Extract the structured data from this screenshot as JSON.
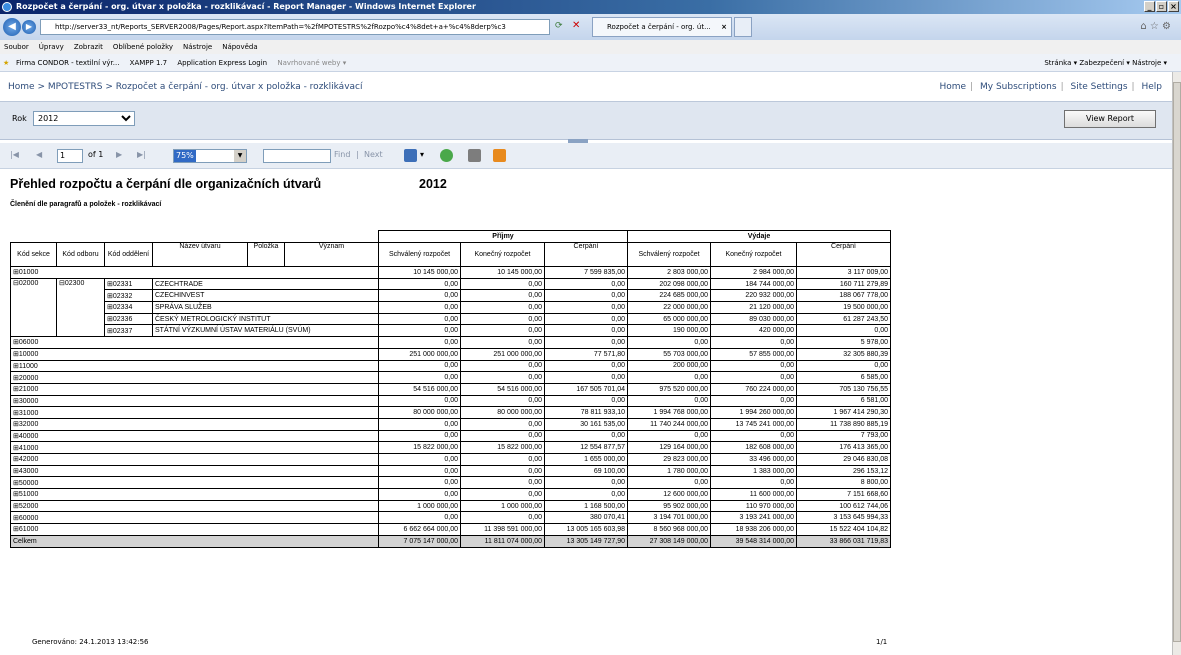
{
  "window": {
    "title": "Rozpočet a čerpání - org. útvar x položka - rozklikávací - Report Manager - Windows Internet Explorer"
  },
  "browser": {
    "url": "http://server33_nt/Reports_SERVER2008/Pages/Report.aspx?ItemPath=%2fMPOTESTRS%2fRozpo%c4%8det+a+%c4%8derp%c3",
    "tab_title": "Rozpočet a čerpání - org. út...",
    "menu": [
      "Soubor",
      "Úpravy",
      "Zobrazit",
      "Oblíbené položky",
      "Nástroje",
      "Nápověda"
    ],
    "favorites": [
      "Firma CONDOR - textilní výr...",
      "XAMPP 1.7",
      "Application Express Login",
      "Navrhované weby ▾"
    ],
    "command_bar": "Stránka ▾  Zabezpečení ▾  Nástroje ▾"
  },
  "ssrs": {
    "breadcrumb": [
      "Home",
      "MPOTESTRS",
      "Rozpočet a čerpání - org. útvar x položka - rozklikávací"
    ],
    "top_links": [
      "Home",
      "My Subscriptions",
      "Site Settings",
      "Help"
    ],
    "param_label": "Rok",
    "param_value": "2012",
    "view_report": "View Report",
    "page_current": "1",
    "page_of": "of 1",
    "zoom": "75%",
    "find": "Find",
    "next": "Next",
    "find_sep": "|"
  },
  "report": {
    "title": "Přehled rozpočtu a čerpání dle organizačních útvarů",
    "year": "2012",
    "subtitle": "Členění dle paragrafů a položek - rozklikávací",
    "group_prijmy": "Příjmy",
    "group_vydaje": "Výdaje",
    "headers": [
      "Kód sekce",
      "Kód odboru",
      "Kód oddělení",
      "Název útvaru",
      "Položka",
      "Význam",
      "Schválený rozpočet",
      "Konečný rozpočet",
      "Čerpání",
      "Schválený rozpočet",
      "Konečný rozpočet",
      "Čerpání"
    ],
    "row_01000": [
      "⊞01000",
      "10 145 000,00",
      "10 145 000,00",
      "7 599 835,00",
      "2 803 000,00",
      "2 984 000,00",
      "3 117 009,00"
    ],
    "sekce_02000": "⊟02000",
    "odbor_02300": "⊟02300",
    "sub_rows": [
      [
        "⊞02331",
        "CZECHTRADE",
        "0,00",
        "0,00",
        "0,00",
        "202 098 000,00",
        "184 744 000,00",
        "160 711 279,89"
      ],
      [
        "⊞02332",
        "CZECHINVEST",
        "0,00",
        "0,00",
        "0,00",
        "224 685 000,00",
        "220 932 000,00",
        "188 067 778,00"
      ],
      [
        "⊞02334",
        "SPRÁVA SLUŽEB",
        "0,00",
        "0,00",
        "0,00",
        "22 000 000,00",
        "21 120 000,00",
        "19 500 000,00"
      ],
      [
        "⊞02336",
        "ČESKÝ METROLOGICKÝ INSTITUT",
        "0,00",
        "0,00",
        "0,00",
        "65 000 000,00",
        "89 030 000,00",
        "61 287 243,50"
      ],
      [
        "⊞02337",
        "STÁTNÍ VÝZKUMNÍ ÚSTAV MATERIÁLU (SVÚM)",
        "0,00",
        "0,00",
        "0,00",
        "190 000,00",
        "420 000,00",
        "0,00"
      ]
    ],
    "rows": [
      [
        "⊞06000",
        "0,00",
        "0,00",
        "0,00",
        "0,00",
        "0,00",
        "5 978,00"
      ],
      [
        "⊞10000",
        "251 000 000,00",
        "251 000 000,00",
        "77 571,80",
        "55 703 000,00",
        "57 855 000,00",
        "32 305 880,39"
      ],
      [
        "⊞11000",
        "0,00",
        "0,00",
        "0,00",
        "200 000,00",
        "0,00",
        "0,00"
      ],
      [
        "⊞20000",
        "0,00",
        "0,00",
        "0,00",
        "0,00",
        "0,00",
        "6 585,00"
      ],
      [
        "⊞21000",
        "54 516 000,00",
        "54 516 000,00",
        "167 505 701,04",
        "975 520 000,00",
        "760 224 000,00",
        "705 130 756,55"
      ],
      [
        "⊞30000",
        "0,00",
        "0,00",
        "0,00",
        "0,00",
        "0,00",
        "6 581,00"
      ],
      [
        "⊞31000",
        "80 000 000,00",
        "80 000 000,00",
        "78 811 933,10",
        "1 994 768 000,00",
        "1 994 260 000,00",
        "1 967 414 290,30"
      ],
      [
        "⊞32000",
        "0,00",
        "0,00",
        "30 161 535,00",
        "11 740 244 000,00",
        "13 745 241 000,00",
        "11 738 890 885,19"
      ],
      [
        "⊞40000",
        "0,00",
        "0,00",
        "0,00",
        "0,00",
        "0,00",
        "7 793,00"
      ],
      [
        "⊞41000",
        "15 822 000,00",
        "15 822 000,00",
        "12 554 877,57",
        "129 164 000,00",
        "182 608 000,00",
        "176 413 365,00"
      ],
      [
        "⊞42000",
        "0,00",
        "0,00",
        "1 655 000,00",
        "29 823 000,00",
        "33 496 000,00",
        "29 046 830,08"
      ],
      [
        "⊞43000",
        "0,00",
        "0,00",
        "69 100,00",
        "1 780 000,00",
        "1 383 000,00",
        "296 153,12"
      ],
      [
        "⊞50000",
        "0,00",
        "0,00",
        "0,00",
        "0,00",
        "0,00",
        "8 800,00"
      ],
      [
        "⊞51000",
        "0,00",
        "0,00",
        "0,00",
        "12 600 000,00",
        "11 600 000,00",
        "7 151 668,60"
      ],
      [
        "⊞52000",
        "1 000 000,00",
        "1 000 000,00",
        "1 168 500,00",
        "95 902 000,00",
        "110 970 000,00",
        "100 612 744,06"
      ],
      [
        "⊞60000",
        "0,00",
        "0,00",
        "380 070,41",
        "3 194 701 000,00",
        "3 193 241 000,00",
        "3 153 645 994,33"
      ],
      [
        "⊞61000",
        "6 662 664 000,00",
        "11 398 591 000,00",
        "13 005 165 603,98",
        "8 560 968 000,00",
        "18 938 206 000,00",
        "15 522 404 104,82"
      ]
    ],
    "total": [
      "Celkem",
      "7 075 147 000,00",
      "11 811 074 000,00",
      "13 305 149 727,90",
      "27 308 149 000,00",
      "39 548 314 000,00",
      "33 866 031 719,83"
    ],
    "generated": "Generováno: 24.1.2013 13:42:56",
    "page": "1/1"
  }
}
